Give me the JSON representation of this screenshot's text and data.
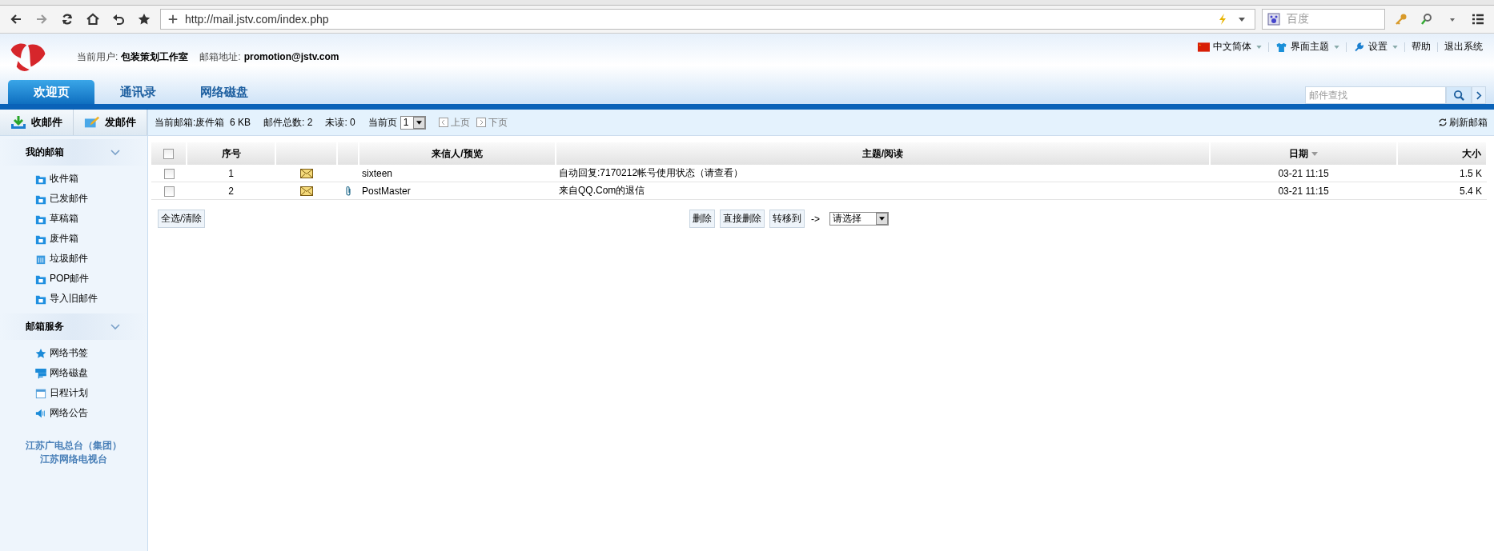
{
  "browser": {
    "url": "http://mail.jstv.com/index.php",
    "search_placeholder": "百度"
  },
  "header": {
    "user_label": "当前用户:",
    "user": "包装策划工作室",
    "address_label": "邮箱地址:",
    "address": "promotion@jstv.com",
    "links": [
      {
        "kind": "flag",
        "label": "中文简体",
        "dropdown": true
      },
      {
        "kind": "shirt",
        "label": "界面主题",
        "dropdown": true
      },
      {
        "kind": "wrench",
        "label": "设置",
        "dropdown": true
      },
      {
        "kind": "plain",
        "label": "帮助",
        "dropdown": false
      },
      {
        "kind": "plain",
        "label": "退出系统",
        "dropdown": false
      }
    ]
  },
  "tabs": [
    {
      "label": "欢迎页",
      "selected": true
    },
    {
      "label": "通讯录",
      "selected": false
    },
    {
      "label": "网络磁盘",
      "selected": false
    }
  ],
  "search": {
    "placeholder": "邮件查找"
  },
  "actions": [
    {
      "kind": "receive",
      "label": "收邮件"
    },
    {
      "kind": "compose",
      "label": "发邮件"
    }
  ],
  "info": {
    "mailbox_label": "当前邮箱:",
    "mailbox": "废件箱  6 KB",
    "total": "邮件总数: 2",
    "unread": "未读: 0",
    "page_label": "当前页",
    "page": "1",
    "prev": "上页",
    "next": "下页",
    "refresh": "刷新邮箱"
  },
  "sidebar": {
    "groups": [
      {
        "title": "我的邮箱",
        "expanded": true,
        "items": [
          {
            "kind": "inbox",
            "label": "收件箱"
          },
          {
            "kind": "sent",
            "label": "已发邮件"
          },
          {
            "kind": "draft",
            "label": "草稿箱"
          },
          {
            "kind": "trash",
            "label": "废件箱"
          },
          {
            "kind": "junk",
            "label": "垃圾邮件"
          },
          {
            "kind": "import",
            "label": "POP邮件"
          },
          {
            "kind": "import",
            "label": "导入旧邮件"
          }
        ]
      },
      {
        "title": "邮箱服务",
        "expanded": true,
        "items": [
          {
            "kind": "star",
            "label": "网络书签"
          },
          {
            "kind": "disk",
            "label": "网络磁盘"
          },
          {
            "kind": "calendar",
            "label": "日程计划"
          },
          {
            "kind": "speaker",
            "label": "网络公告"
          }
        ]
      }
    ],
    "footer": [
      "江苏广电总台（集团）",
      "江苏网络电视台"
    ]
  },
  "table": {
    "header_checked": false,
    "headers": {
      "index": "序号",
      "sender": "来信人/预览",
      "subject": "主题/阅读",
      "date": "日期",
      "size": "大小"
    },
    "rows": [
      {
        "checked": false,
        "index": "1",
        "attachment": false,
        "sender": "sixteen",
        "subject": "自动回复:7170212帐号使用状态（请查看）",
        "date": "03-21 11:15",
        "size": "1.5 K"
      },
      {
        "checked": false,
        "index": "2",
        "attachment": true,
        "sender": "PostMaster",
        "subject": "来自QQ.Com的退信",
        "date": "03-21 11:15",
        "size": "5.4 K"
      }
    ]
  },
  "bottom": {
    "select_all": "全选/清除",
    "buttons": [
      "删除",
      "直接删除",
      "转移到"
    ],
    "arrow": "->",
    "move_target": "请选择"
  }
}
